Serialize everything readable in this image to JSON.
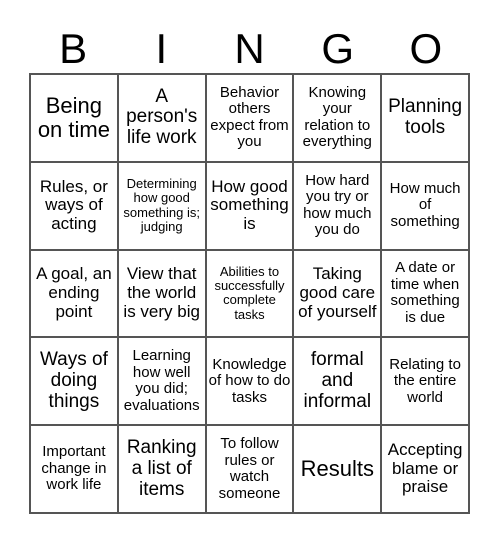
{
  "header": {
    "letters": [
      "B",
      "I",
      "N",
      "G",
      "O"
    ]
  },
  "board": {
    "cells": [
      [
        "Being on time",
        "A person's life work",
        "Behavior others expect from you",
        "Knowing your relation to everything",
        "Planning tools"
      ],
      [
        "Rules, or ways of acting",
        "Determining how good something is; judging",
        "How good something is",
        "How hard you try or how much you do",
        "How much of something"
      ],
      [
        "A goal, an ending point",
        "View that the world is very big",
        "Abilities to successfully complete tasks",
        "Taking good care of yourself",
        "A date or time when something is due"
      ],
      [
        "Ways of doing things",
        "Learning how well you did; evaluations",
        "Knowledge of how to do tasks",
        "formal and informal",
        "Relating to the entire world"
      ],
      [
        "Important change in work life",
        "Ranking a list of items",
        "To follow rules or watch someone",
        "Results",
        "Accepting blame or praise"
      ]
    ]
  }
}
